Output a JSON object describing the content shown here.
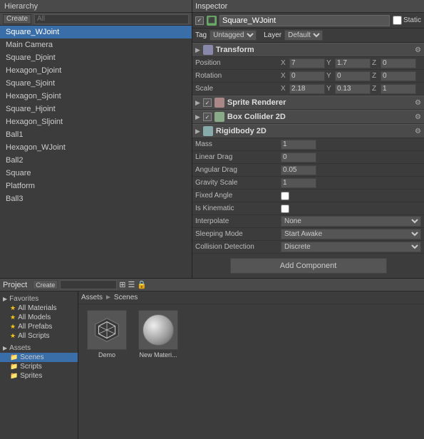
{
  "hierarchy": {
    "title": "Hierarchy",
    "create_label": "Create",
    "search_placeholder": "All",
    "items": [
      {
        "label": "Square_WJoint",
        "selected": true
      },
      {
        "label": "Main Camera",
        "selected": false
      },
      {
        "label": "Square_Djoint",
        "selected": false
      },
      {
        "label": "Hexagon_Djoint",
        "selected": false
      },
      {
        "label": "Square_Sjoint",
        "selected": false
      },
      {
        "label": "Hexagon_Sjoint",
        "selected": false
      },
      {
        "label": "Square_Hjoint",
        "selected": false
      },
      {
        "label": "Hexagon_Sljoint",
        "selected": false
      },
      {
        "label": "Ball1",
        "selected": false
      },
      {
        "label": "Hexagon_WJoint",
        "selected": false
      },
      {
        "label": "Ball2",
        "selected": false
      },
      {
        "label": "Square",
        "selected": false
      },
      {
        "label": "Platform",
        "selected": false
      },
      {
        "label": "Ball3",
        "selected": false
      }
    ]
  },
  "inspector": {
    "title": "Inspector",
    "object_name": "Square_WJoint",
    "static_label": "Static",
    "tag_label": "Tag",
    "tag_value": "Untagged",
    "layer_label": "Layer",
    "layer_value": "Default",
    "transform": {
      "label": "Transform",
      "position_label": "Position",
      "pos_x_label": "X",
      "pos_x_value": "7",
      "pos_y_label": "Y",
      "pos_y_value": "1.7",
      "pos_z_label": "Z",
      "pos_z_value": "0",
      "rotation_label": "Rotation",
      "rot_x_label": "X",
      "rot_x_value": "0",
      "rot_y_label": "Y",
      "rot_y_value": "0",
      "rot_z_label": "Z",
      "rot_z_value": "0",
      "scale_label": "Scale",
      "scale_x_label": "X",
      "scale_x_value": "2.18",
      "scale_y_label": "Y",
      "scale_y_value": "0.13",
      "scale_z_label": "Z",
      "scale_z_value": "1"
    },
    "sprite_renderer": {
      "label": "Sprite Renderer"
    },
    "box_collider": {
      "label": "Box Collider 2D"
    },
    "rigidbody": {
      "label": "Rigidbody 2D",
      "mass_label": "Mass",
      "mass_value": "1",
      "linear_drag_label": "Linear Drag",
      "linear_drag_value": "0",
      "angular_drag_label": "Angular Drag",
      "angular_drag_value": "0.05",
      "gravity_scale_label": "Gravity Scale",
      "gravity_scale_value": "1",
      "fixed_angle_label": "Fixed Angle",
      "is_kinematic_label": "Is Kinematic",
      "interpolate_label": "Interpolate",
      "interpolate_value": "None",
      "sleeping_mode_label": "Sleeping Mode",
      "sleeping_mode_value": "Start Awake",
      "collision_detection_label": "Collision Detection",
      "collision_detection_value": "Discrete"
    },
    "add_component_label": "Add Component"
  },
  "project": {
    "title": "Project",
    "create_label": "Create",
    "breadcrumb": {
      "part1": "Assets",
      "sep": "►",
      "part2": "Scenes"
    },
    "sidebar": {
      "favorites_label": "Favorites",
      "favorites_items": [
        "All Materials",
        "All Models",
        "All Prefabs",
        "All Scripts"
      ],
      "assets_label": "Assets",
      "assets_items": [
        "Scenes",
        "Scripts",
        "Sprites"
      ]
    },
    "assets": [
      {
        "name": "Demo",
        "type": "scene"
      },
      {
        "name": "New Materi...",
        "type": "material"
      }
    ]
  }
}
